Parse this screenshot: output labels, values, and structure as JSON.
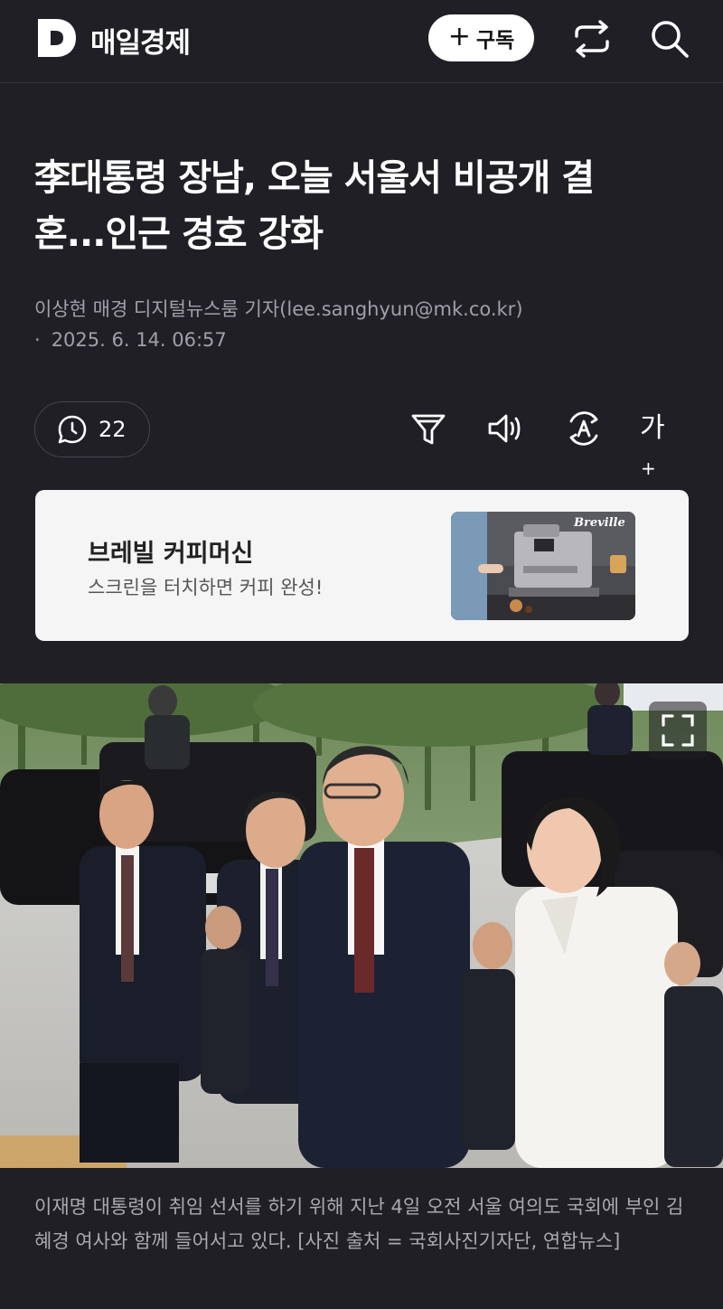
{
  "header": {
    "logo_letter": "D",
    "brand": "매일경제",
    "subscribe_label": "구독",
    "subscribe_icon": "plus-icon",
    "share_icon": "share-icon",
    "search_icon": "search-icon"
  },
  "article": {
    "headline_line1": "李대통령 장남, 오늘 서울서 비공개 결",
    "headline_line2": "혼...인근 경호 강화",
    "byline": "이상현 매경 디지털뉴스룸 기자(lee.sanghyun@mk.co.kr)",
    "date_bullet": "·",
    "date": "2025. 6. 14. 06:57"
  },
  "toolbar": {
    "comment_count": "22",
    "comment_icon": "comment-icon",
    "filter_icon": "filter-icon",
    "speaker_icon": "speaker-icon",
    "translate_icon": "translate-icon",
    "fontsize_label": "가",
    "fontsize_plus": "+"
  },
  "ad": {
    "title": "브레빌 커피머신",
    "subtitle": "스크린을 터치하면 커피 완성!",
    "image_brand": "Breville"
  },
  "photo": {
    "expand_icon": "expand-icon"
  },
  "caption": "이재명 대통령이 취임 선서를 하기 위해 지난 4일 오전 서울 여의도 국회에 부인 김혜경 여사와 함께 들어서고 있다. [사진 출처 = 국회사진기자단, 연합뉴스]",
  "colors": {
    "background": "#1f1f25",
    "text_primary": "#ffffff",
    "text_secondary": "#a0a0a8",
    "ad_background": "#f5f5f6"
  }
}
